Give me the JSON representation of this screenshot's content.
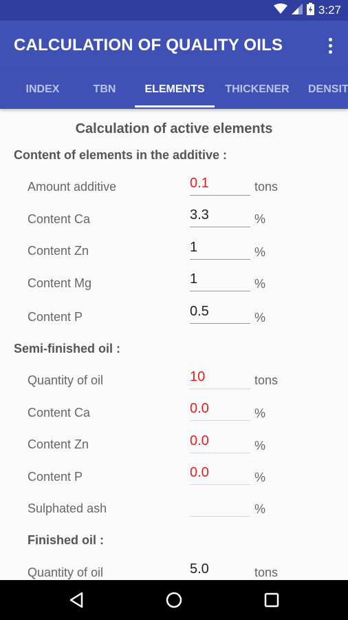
{
  "status_bar": {
    "time": "3:27",
    "icons": [
      "wifi-icon",
      "signal-icon",
      "battery-icon"
    ]
  },
  "app_bar": {
    "title": "CALCULATION OF QUALITY OILS",
    "menu_icon": "more-vert-icon"
  },
  "tabs": [
    {
      "label": "INDEX"
    },
    {
      "label": "TBN"
    },
    {
      "label": "ELEMENTS",
      "active": true
    },
    {
      "label": "THICKENER"
    },
    {
      "label": "DENSITY"
    }
  ],
  "heading": "Calculation of active elements",
  "additive": {
    "title": "Content of elements in the additive :",
    "rows": [
      {
        "label": "Amount additive",
        "value": "0.1",
        "unit": "tons"
      },
      {
        "label": "Content Ca",
        "value": "3.3",
        "unit": "%"
      },
      {
        "label": "Content Zn",
        "value": "1",
        "unit": "%"
      },
      {
        "label": "Content Mg",
        "value": "1",
        "unit": "%"
      },
      {
        "label": "Content P",
        "value": "0.5",
        "unit": "%"
      }
    ]
  },
  "semi_finished": {
    "title": "Semi-finished oil :",
    "rows": [
      {
        "label": "Quantity of oil",
        "value": "10",
        "unit": "tons"
      },
      {
        "label": "Content Ca",
        "value": "0.0",
        "unit": "%"
      },
      {
        "label": "Content Zn",
        "value": "0.0",
        "unit": "%"
      },
      {
        "label": "Content P",
        "value": "0.0",
        "unit": "%"
      },
      {
        "label": "Sulphated ash",
        "value": "",
        "unit": "%"
      }
    ]
  },
  "finished": {
    "title": "Finished oil :",
    "rows": [
      {
        "label": "Quantity of oil",
        "value": "5.0",
        "unit": "tons"
      }
    ]
  },
  "colors": {
    "primary": "#3f51b5",
    "primary_dark": "#303f9f",
    "calculated_value": "#e81c1c"
  },
  "nav_bar": {
    "icons": [
      "back-icon",
      "home-icon",
      "recents-icon"
    ]
  }
}
